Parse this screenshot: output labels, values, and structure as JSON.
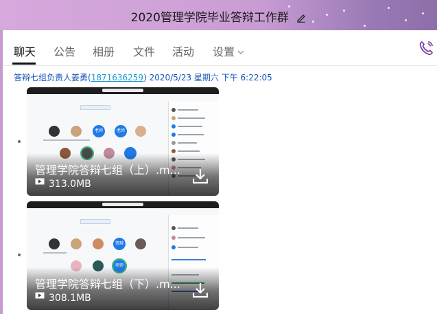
{
  "window": {
    "title": "2020管理学院毕业答辩工作群",
    "title_bar_color": "#cfa2d8"
  },
  "tabs": [
    {
      "label": "聊天",
      "active": true
    },
    {
      "label": "公告",
      "active": false
    },
    {
      "label": "相册",
      "active": false
    },
    {
      "label": "文件",
      "active": false
    },
    {
      "label": "活动",
      "active": false
    },
    {
      "label": "设置",
      "active": false
    }
  ],
  "message": {
    "sender": "答辩七组负责人姜勇",
    "qq_open": "(",
    "qq": "1871636259",
    "qq_close": ")",
    "timestamp": "2020/5/23 星期六 下午 6:22:05"
  },
  "attachments": [
    {
      "file_name": "管理学院答辩七组（上）.m...",
      "size": "313.0MB"
    },
    {
      "file_name": "管理学院答辩七组（下）.m...",
      "size": "308.1MB"
    }
  ],
  "thumb_labels": {
    "teacher": "老师",
    "defense": "答辩"
  },
  "colors": {
    "link": "#1a9ad6",
    "sender": "#1455b8",
    "accent": "#7b3fa6"
  }
}
